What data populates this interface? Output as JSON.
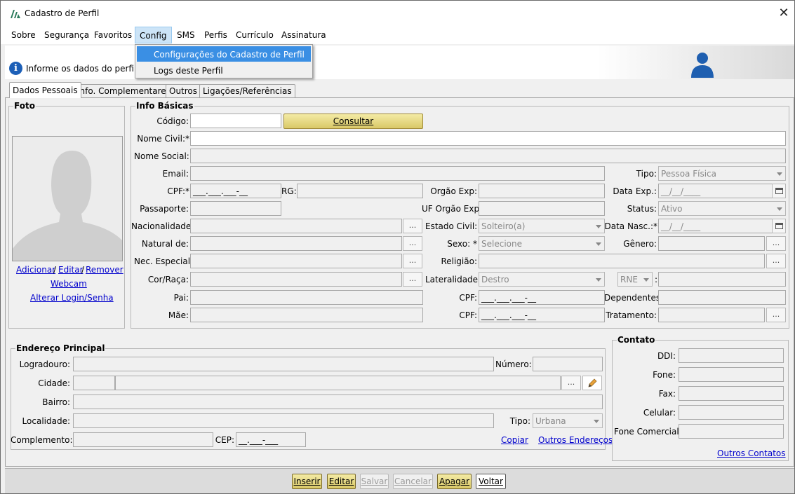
{
  "window": {
    "title": "Cadastro de Perfil",
    "close_glyph": "✕"
  },
  "menu": [
    "Sobre",
    "Segurança",
    "Favoritos",
    "Config",
    "SMS",
    "Perfis",
    "Currículo",
    "Assinatura"
  ],
  "dropdown": [
    "Configurações do Cadastro de Perfil",
    "Logs deste Perfil"
  ],
  "banner": {
    "text": "Informe os dados do perfil...",
    "icon": "info-icon"
  },
  "tabs": [
    "Dados Pessoais",
    "Info. Complementares",
    "Outros",
    "Ligações/Referências"
  ],
  "foto": {
    "title": "Foto",
    "adicionar": "Adicionar",
    "sep1": "/",
    "editar": "Editar",
    "sep2": "/",
    "remover": "Remover",
    "webcam": "Webcam",
    "alterar": "Alterar Login/Senha"
  },
  "info": {
    "title": "Info Básicas",
    "codigo": "Código:",
    "consultar": "Consultar",
    "nome_civil": "Nome Civil:*",
    "nome_social": "Nome Social:",
    "email": "Email:",
    "tipo": "Tipo:",
    "tipo_value": "Pessoa Física",
    "cpf": "CPF:*",
    "cpf_mask": "___.___.___-__",
    "rg": "RG:",
    "orgao_exp": "Orgão Exp:",
    "data_exp": "Data Exp.:",
    "date_mask": "__/__/____",
    "passaporte": "Passaporte:",
    "uf_orgao": "UF Orgão Exp:",
    "status": "Status:",
    "status_value": "Ativo",
    "nacionalidade": "Nacionalidade:",
    "estado_civil": "Estado Civil:",
    "estado_civil_value": "Solteiro(a)",
    "data_nasc": "Data Nasc.:*",
    "natural_de": "Natural de:",
    "sexo": "Sexo: *",
    "sexo_value": "Selecione",
    "genero": "Gênero:",
    "nec_especial": "Nec. Especial:",
    "religiao": "Religião:",
    "cor_raca": "Cor/Raça:",
    "lateralidade": "Lateralidade:",
    "lateralidade_value": "Destro",
    "rne_value": "RNE",
    "rne_colon": ":",
    "pai": "Pai:",
    "cpf2": "CPF:",
    "dependentes": "Dependentes:",
    "mae": "Mãe:",
    "cpf3": "CPF:",
    "tratamento": "Tratamento:",
    "dots": "..."
  },
  "endereco": {
    "title": "Endereço Principal",
    "logradouro": "Logradouro:",
    "numero": "Número:",
    "cidade": "Cidade:",
    "bairro": "Bairro:",
    "localidade": "Localidade:",
    "tipo": "Tipo:",
    "tipo_value": "Urbana",
    "complemento": "Complemento:",
    "cep": "CEP:",
    "cep_mask": "__.___-___",
    "copiar": "Copiar",
    "outros_enderecos": "Outros Endereços"
  },
  "contato": {
    "title": "Contato",
    "ddi": "DDI:",
    "fone": "Fone:",
    "fax": "Fax:",
    "celular": "Celular:",
    "fone_comercial": "Fone Comercial:",
    "outros_contatos": "Outros Contatos"
  },
  "buttons": [
    "Inserir",
    "Editar",
    "Salvar",
    "Cancelar",
    "Apagar",
    "Voltar"
  ]
}
